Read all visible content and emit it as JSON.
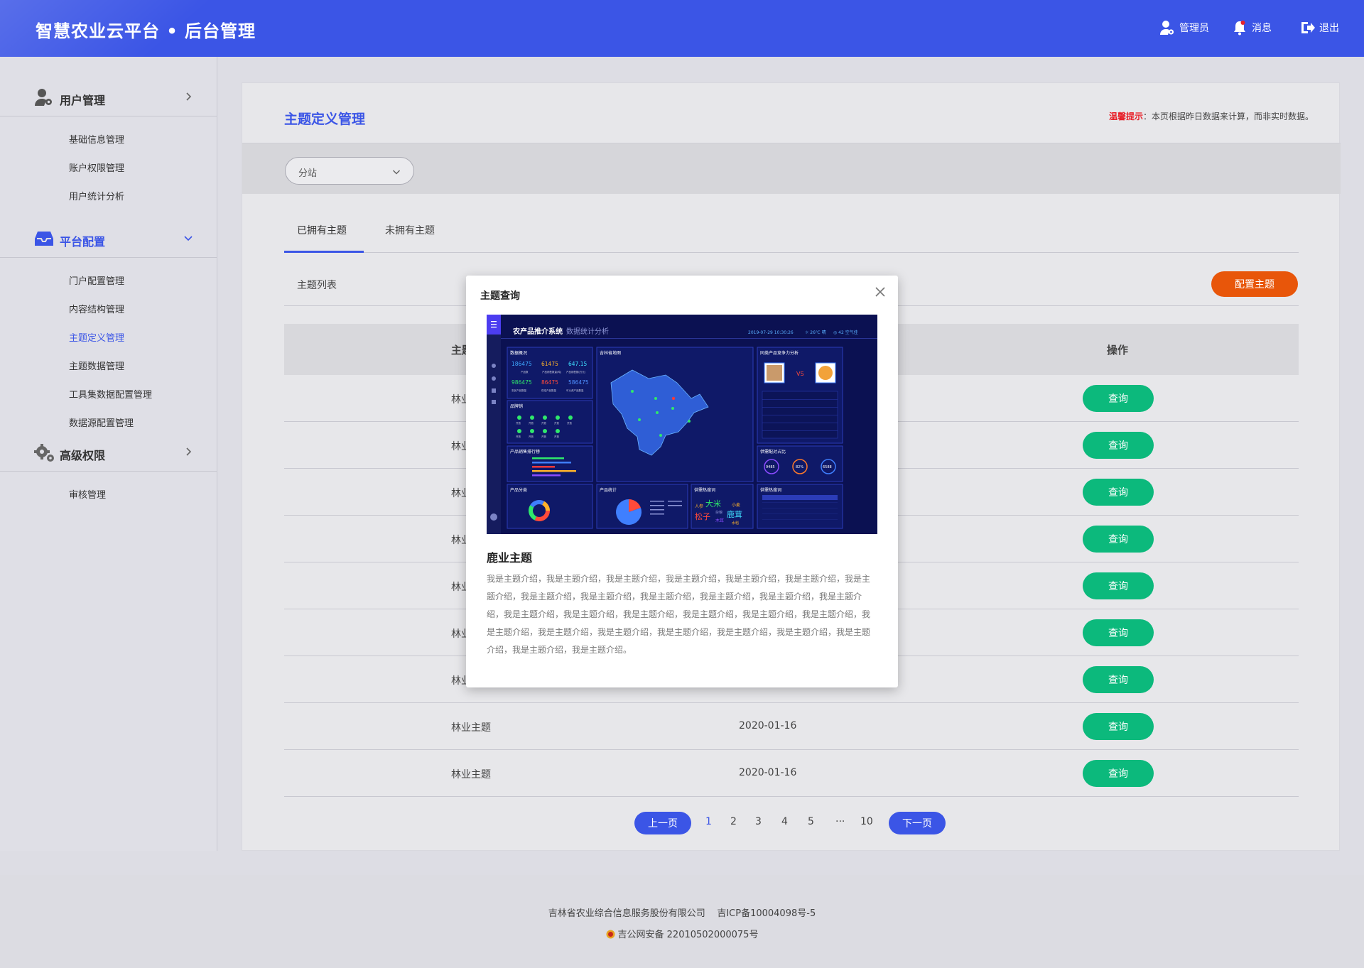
{
  "header": {
    "title": "智慧农业云平台 • 后台管理",
    "user_label": "管理员",
    "message_label": "消息",
    "logout_label": "退出"
  },
  "sidebar": {
    "groups": [
      {
        "label": "用户管理",
        "items": [
          "基础信息管理",
          "账户权限管理",
          "用户统计分析"
        ]
      },
      {
        "label": "平台配置",
        "items": [
          "门户配置管理",
          "内容结构管理",
          "主题定义管理",
          "主题数据管理",
          "工具集数据配置管理",
          "数据源配置管理"
        ]
      },
      {
        "label": "高级权限",
        "items": [
          "审核管理"
        ]
      }
    ],
    "active_item": "主题定义管理"
  },
  "main": {
    "page_title": "主题定义管理",
    "notice_label": "温馨提示",
    "notice_text": "：本页根据昨日数据来计算，而非实时数据。",
    "filter": {
      "selected": "分站"
    },
    "tabs": [
      "已拥有主题",
      "未拥有主题"
    ],
    "active_tab": 0,
    "list_label": "主题列表",
    "config_button": "配置主题",
    "table": {
      "headers": [
        "主题",
        "",
        "操作"
      ],
      "rows": [
        {
          "name": "林业",
          "date": "",
          "action": "查询"
        },
        {
          "name": "林业",
          "date": "",
          "action": "查询"
        },
        {
          "name": "林业",
          "date": "",
          "action": "查询"
        },
        {
          "name": "林业",
          "date": "",
          "action": "查询"
        },
        {
          "name": "林业",
          "date": "",
          "action": "查询"
        },
        {
          "name": "林业",
          "date": "",
          "action": "查询"
        },
        {
          "name": "林业",
          "date": "",
          "action": "查询"
        },
        {
          "name": "林业主题",
          "date": "2020-01-16",
          "action": "查询"
        },
        {
          "name": "林业主题",
          "date": "2020-01-16",
          "action": "查询"
        }
      ]
    },
    "pagination": {
      "prev": "上一页",
      "pages": [
        "1",
        "2",
        "3",
        "4",
        "5",
        "···",
        "10"
      ],
      "current": "1",
      "next": "下一页"
    }
  },
  "modal": {
    "title": "主题查询",
    "theme_name": "鹿业主题",
    "description": "我是主题介绍，我是主题介绍，我是主题介绍，我是主题介绍，我是主题介绍，我是主题介绍，我是主题介绍，我是主题介绍，我是主题介绍，我是主题介绍，我是主题介绍，我是主题介绍，我是主题介绍，我是主题介绍，我是主题介绍，我是主题介绍，我是主题介绍，我是主题介绍，我是主题介绍，我是主题介绍，我是主题介绍，我是主题介绍，我是主题介绍，我是主题介绍，我是主题介绍，我是主题介绍，我是主题介绍，我是主题介绍。",
    "preview": {
      "system_title": "农产品推介系统",
      "system_subtitle": "数据统计分析",
      "datetime": "2019-07-29  10:30:26",
      "weather": "☼ 26℃ 晴",
      "air": "◎ 42 空气佳",
      "panel_overview": "数据概况",
      "stats": [
        "186475",
        "61475",
        "647.15",
        "986475",
        "86475",
        "586475"
      ],
      "stat_labels": [
        "产品数",
        "产品销售数量(吨)",
        "产品销售额(万元)",
        "农民产品数量",
        "供给产品数量",
        "可以资产品数量"
      ],
      "panel_market": "品牌销",
      "market_tag": "开放",
      "panel_ranking": "产品销售排行榜",
      "panel_map": "吉林省地图",
      "panel_compete": "同类产品竞争力分析",
      "compete_vs": "VS",
      "panel_supply": "供需配对占比",
      "supply_values": [
        "9485",
        "82%",
        "6588"
      ],
      "panel_category": "产品分类",
      "panel_stats": "产品统计",
      "panel_hotwords": "供需热搜词",
      "hotwords": [
        "人参",
        "大米",
        "小麦",
        "松子",
        "木耳",
        "鹿茸",
        "杂粮",
        "水稻"
      ],
      "panel_hotlist": "供需热搜词"
    }
  },
  "footer": {
    "company": "吉林省农业综合信息服务股份有限公司",
    "icp": "吉ICP备10004098号-5",
    "police": "吉公网安备 22010502000075号"
  },
  "colors": {
    "primary": "#3b55e6",
    "danger": "#e8560a",
    "success": "#0cb97c",
    "notice_red": "#e8212a"
  }
}
